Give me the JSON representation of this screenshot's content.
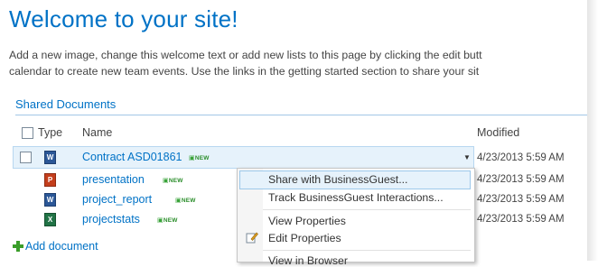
{
  "page": {
    "title": "Welcome to your site!",
    "intro_line1": "Add a new image, change this welcome text or add new lists to this page by clicking the edit butt",
    "intro_line2": "calendar to create new team events. Use the links in the getting started section to share your sit"
  },
  "library": {
    "title": "Shared Documents",
    "columns": {
      "type": "Type",
      "name": "Name",
      "modified": "Modified"
    },
    "new_badge": "NEW",
    "rows": [
      {
        "name": "Contract ASD01861",
        "modified": "4/23/2013 5:59 AM",
        "icon": "word-icon"
      },
      {
        "name": "presentation",
        "modified": "4/23/2013 5:59 AM",
        "icon": "powerpoint-icon"
      },
      {
        "name": "project_report",
        "modified": "4/23/2013 5:59 AM",
        "icon": "word-icon"
      },
      {
        "name": "projectstats",
        "modified": "4/23/2013 5:59 AM",
        "icon": "excel-icon"
      }
    ],
    "add_document": "Add document"
  },
  "context_menu": {
    "items": [
      {
        "label": "Share with BusinessGuest..."
      },
      {
        "label": "Track BusinessGuest Interactions..."
      },
      {
        "label": "View Properties"
      },
      {
        "label": "Edit Properties"
      },
      {
        "label": "View in Browser"
      }
    ]
  },
  "colors": {
    "accent": "#0072c6",
    "selection": "#e6f2fb",
    "new_badge": "#2a8d2a"
  }
}
